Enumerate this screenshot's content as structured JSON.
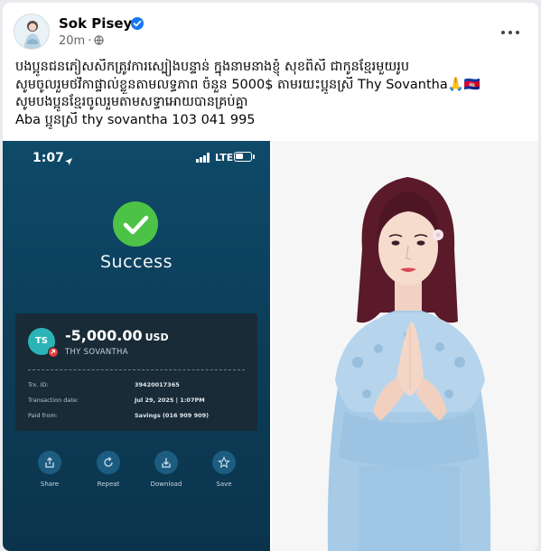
{
  "post": {
    "author": "Sok Pisey",
    "time": "20m",
    "text_lines": [
      "បងប្អូនជនភៀសសឹកត្រូវការស្បៀងបន្ទាន់ ក្នុងនាមនាងខ្ញុំ សុខពិសី ជាកូនខ្មែរមួយរូប",
      "សូមចូលរួមថវិកាផ្ទាល់ខ្លួនតាមលទ្ធភាព ចំនួន 5000$ តាមរយះប្អូនស្រី Thy Sovantha🙏🇰🇭",
      "សូមបងប្អូនខ្មែរចូលរួមតាមសទ្ធាអោយបានគ្រប់គ្នា",
      "Aba ប្អូនស្រី thy sovantha 103 041 995"
    ]
  },
  "receipt": {
    "status_time": "1:07",
    "network": "LTE",
    "success_label": "Success",
    "avatar_initials": "TS",
    "amount": "-5,000.00",
    "currency": "USD",
    "payee": "THY SOVANTHA",
    "details": [
      {
        "label": "Trx. ID:",
        "value": "39420017365"
      },
      {
        "label": "Transaction date:",
        "value": "Jul 29, 2025 | 1:07PM"
      },
      {
        "label": "Paid from:",
        "value": "Savings (016 909 909)"
      }
    ],
    "actions": [
      {
        "label": "Share",
        "icon": "share-icon"
      },
      {
        "label": "Repeat",
        "icon": "repeat-icon"
      },
      {
        "label": "Download",
        "icon": "download-icon"
      },
      {
        "label": "Save",
        "icon": "star-icon"
      }
    ]
  },
  "colors": {
    "verified": "#1877f2",
    "success": "#4cc247",
    "receipt_bg": "#0e4a69",
    "dress": "#9cc6e6"
  }
}
